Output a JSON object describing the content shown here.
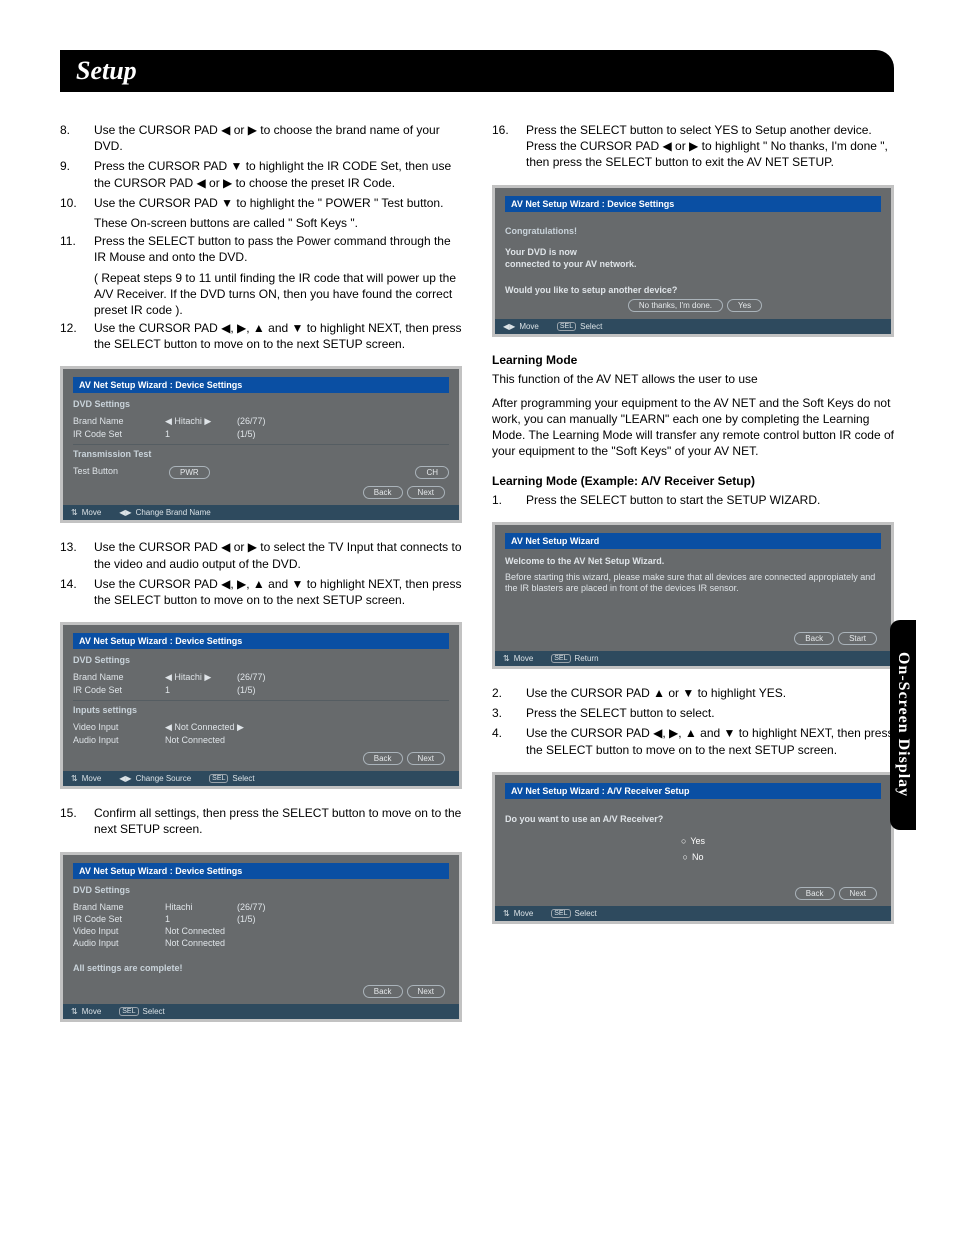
{
  "page_title": "Setup",
  "side_tab": "On-Screen Display",
  "left_steps": {
    "s8": "Use the CURSOR PAD ◀ or ▶ to choose the brand name of your DVD.",
    "s9": "Press the CURSOR PAD ▼ to highlight the IR CODE Set, then use the CURSOR PAD ◀ or ▶ to choose the preset IR Code.",
    "s10": "Use the CURSOR PAD ▼ to highlight the \" POWER \" Test button.",
    "s10b": "These On-screen buttons are called \" Soft Keys \".",
    "s11": "Press the SELECT button to pass the Power command through the IR Mouse and onto the DVD.",
    "s11b": "( Repeat steps 9 to 11 until finding the IR code that will power up  the A/V Receiver. If the DVD turns ON, then you have found the correct preset IR code ).",
    "s12": "Use the CURSOR PAD ◀, ▶, ▲ and ▼ to highlight NEXT, then press the SELECT button to move on to the next SETUP screen.",
    "s13": "Use the CURSOR PAD ◀ or ▶ to select the TV Input that connects to the video and audio output of the DVD.",
    "s14": "Use the CURSOR PAD ◀, ▶, ▲ and ▼ to highlight NEXT, then press the SELECT button to move on to the next SETUP screen.",
    "s15": "Confirm all settings, then  press the SELECT button to move on to the next SETUP screen."
  },
  "right_steps": {
    "s16": "Press the SELECT button to select YES to Setup another device.  Press the CURSOR PAD ◀ or ▶ to highlight \" No thanks, I'm done \", then press the SELECT button to exit the AV NET SETUP.",
    "lm_hdr": "Learning Mode",
    "lm_p1": "This function of the AV NET allows the user to  use",
    "lm_p2": "After programming your equipment to the AV NET and the Soft Keys do not work, you can manually \"LEARN\" each one by completing the Learning Mode.  The Learning Mode will transfer any remote control button IR code of your equipment to the \"Soft Keys\" of your AV NET.",
    "lm2_hdr": "Learning Mode (Example: A/V Receiver Setup)",
    "r1": "Press the SELECT button to start the SETUP WIZARD.",
    "r2": "Use the CURSOR PAD ▲ or ▼ to highlight YES.",
    "r3": "Press the SELECT button to select.",
    "r4": "Use the CURSOR PAD ◀, ▶, ▲ and ▼ to highlight NEXT, then press the SELECT button to move on to the next SETUP screen."
  },
  "osd1": {
    "title": "AV Net Setup Wizard : Device Settings",
    "sec1": "DVD Settings",
    "brand_lbl": "Brand Name",
    "brand_val": "◀  Hitachi  ▶",
    "brand_cnt": "(26/77)",
    "ir_lbl": "IR Code Set",
    "ir_val": "1",
    "ir_cnt": "(1/5)",
    "sec2": "Transmission Test",
    "test_lbl": "Test Button",
    "pwr": "PWR",
    "ch": "CH",
    "back": "Back",
    "next": "Next",
    "foot_move": "Move",
    "foot_change": "Change Brand Name"
  },
  "osd2": {
    "title": "AV Net Setup Wizard : Device Settings",
    "sec1": "DVD Settings",
    "brand_lbl": "Brand Name",
    "brand_val": "◀  Hitachi  ▶",
    "brand_cnt": "(26/77)",
    "ir_lbl": "IR Code Set",
    "ir_val": "1",
    "ir_cnt": "(1/5)",
    "sec2": "Inputs settings",
    "vi_lbl": "Video Input",
    "vi_val": "◀  Not Connected  ▶",
    "ai_lbl": "Audio Input",
    "ai_val": "Not Connected",
    "back": "Back",
    "next": "Next",
    "foot_move": "Move",
    "foot_change": "Change Source",
    "foot_sel": "Select"
  },
  "osd3": {
    "title": "AV Net Setup Wizard : Device Settings",
    "sec1": "DVD Settings",
    "brand_lbl": "Brand Name",
    "brand_val": "Hitachi",
    "brand_cnt": "(26/77)",
    "ir_lbl": "IR Code Set",
    "ir_val": "1",
    "ir_cnt": "(1/5)",
    "vi_lbl": "Video Input",
    "vi_val": "Not Connected",
    "ai_lbl": "Audio Input",
    "ai_val": "Not Connected",
    "complete": "All settings are complete!",
    "back": "Back",
    "next": "Next",
    "foot_move": "Move",
    "foot_sel": "Select"
  },
  "osd4": {
    "title": "AV Net Setup Wizard : Device Settings",
    "l1": "Congratulations!",
    "l2": "Your DVD is now",
    "l3": "connected to your AV network.",
    "q": "Would you like to setup another device?",
    "no": "No thanks, I'm done.",
    "yes": "Yes",
    "foot_move": "Move",
    "foot_sel": "Select"
  },
  "osd5": {
    "title": "AV Net Setup Wizard",
    "welcome": "Welcome to the AV Net Setup Wizard.",
    "msg": "Before starting this wizard, please make sure that all devices are connected appropiately and the IR blasters are placed in front of the devices IR sensor.",
    "back": "Back",
    "start": "Start",
    "foot_move": "Move",
    "foot_ret": "Return"
  },
  "osd6": {
    "title": "AV Net Setup Wizard : A/V Receiver Setup",
    "q": "Do you want to use an A/V Receiver?",
    "yes": "Yes",
    "no": "No",
    "back": "Back",
    "next": "Next",
    "foot_move": "Move",
    "foot_sel": "Select"
  }
}
